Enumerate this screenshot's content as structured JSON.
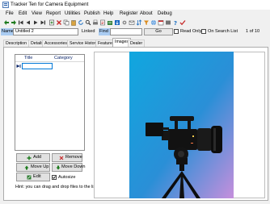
{
  "window": {
    "title": "Tracker Ten for Camera Equipment"
  },
  "menu": [
    "File",
    "Edit",
    "View",
    "Report",
    "Utilities",
    "Publish",
    "Help",
    "Register",
    "About",
    "Debug"
  ],
  "toolbar_icons": [
    "back-arrow-icon",
    "forward-arrow-icon",
    "first-record-icon",
    "previous-record-icon",
    "next-record-icon",
    "last-record-icon",
    "new-record-icon",
    "delete-record-icon",
    "copy-icon",
    "paste-icon",
    "refresh-icon",
    "find-icon",
    "print-icon",
    "report-icon",
    "export-icon",
    "import-icon",
    "options-icon",
    "email-icon",
    "sort-icon",
    "filter-icon",
    "web-icon",
    "calendar-icon",
    "barcode-icon",
    "help-icon",
    "tick-icon"
  ],
  "record_bar": {
    "name_label": "Name",
    "name_value": "Untitled 2",
    "linked_label": "Linked",
    "find_label": "Find",
    "find_value": "",
    "go_label": "Go",
    "read_only_label": "Read Only",
    "on_search_list_label": "On Search List",
    "record_position": "1 of 10"
  },
  "tabs": [
    "Description",
    "Details",
    "Accessories",
    "Service History",
    "Features",
    "Images",
    "Dealer"
  ],
  "active_tab": "Images",
  "image_list": {
    "columns": [
      "Title",
      "Category"
    ],
    "rows": [
      {
        "title": "",
        "category": ""
      }
    ]
  },
  "buttons": {
    "add": "Add",
    "remove": "Remove",
    "move_up": "Move Up",
    "move_down": "Move Down",
    "edit": "Edit",
    "autosize": "Autosize"
  },
  "autosize_checked": true,
  "hint": "Hint: you can drag and drop files to the list.",
  "colors": {
    "label_blue": "#aaccf2",
    "photo_blue": "#1fa6d8",
    "photo_pink": "#c58fd9",
    "selection_blue": "#0078d7"
  }
}
